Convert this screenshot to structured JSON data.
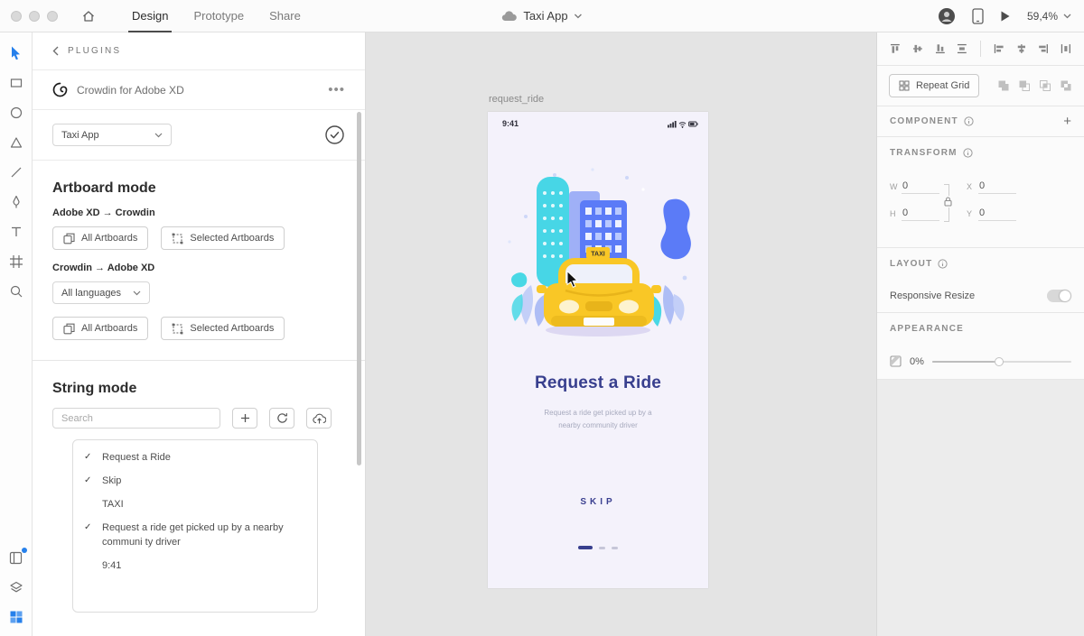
{
  "colors": {
    "accent_blue": "#2680eb",
    "navy": "#383f8e",
    "taxi_yellow": "#f9c726",
    "teal": "#47d6e6",
    "building_blue": "#5b7bf7",
    "canvas_gray": "#e4e4e4"
  },
  "topbar": {
    "tabs": [
      {
        "label": "Design"
      },
      {
        "label": "Prototype"
      },
      {
        "label": "Share"
      }
    ],
    "doc_title": "Taxi App",
    "zoom_level": "59,4%"
  },
  "plugins_panel": {
    "header": "PLUGINS",
    "plugin_name": "Crowdin for Adobe XD",
    "menu_dots": "•••",
    "project_select": "Taxi App",
    "artboard_mode": {
      "title": "Artboard mode",
      "direction_push": "Adobe XD → Crowdin",
      "direction_pull": "Crowdin → Adobe XD",
      "all_artboards": "All Artboards",
      "selected_artboards": "Selected Artboards",
      "languages_select": "All languages"
    },
    "string_mode": {
      "title": "String mode",
      "search_placeholder": "Search",
      "strings": [
        {
          "mark": "✓",
          "text": "Request a Ride"
        },
        {
          "mark": "✓",
          "text": "Skip"
        },
        {
          "mark": "",
          "text": "TAXI"
        },
        {
          "mark": "✓",
          "text": "Request a ride get picked up by a nearby communi ty driver"
        },
        {
          "mark": "",
          "text": "9:41"
        }
      ]
    }
  },
  "canvas": {
    "artboard_label": "request_ride",
    "artboard": {
      "status_time": "9:41",
      "taxi_sign": "TAXI",
      "heading": "Request a Ride",
      "subtitle_line1": "Request a ride get picked up by a",
      "subtitle_line2": "nearby community driver",
      "skip": "SKIP"
    }
  },
  "inspector": {
    "repeat_grid": "Repeat Grid",
    "component_header": "COMPONENT",
    "transform_header": "TRANSFORM",
    "fields": {
      "w_label": "W",
      "h_label": "H",
      "x_label": "X",
      "y_label": "Y",
      "w": "0",
      "h": "0",
      "x": "0",
      "y": "0"
    },
    "layout_header": "LAYOUT",
    "responsive_resize": "Responsive Resize",
    "appearance_header": "APPEARANCE",
    "opacity": "0%"
  }
}
